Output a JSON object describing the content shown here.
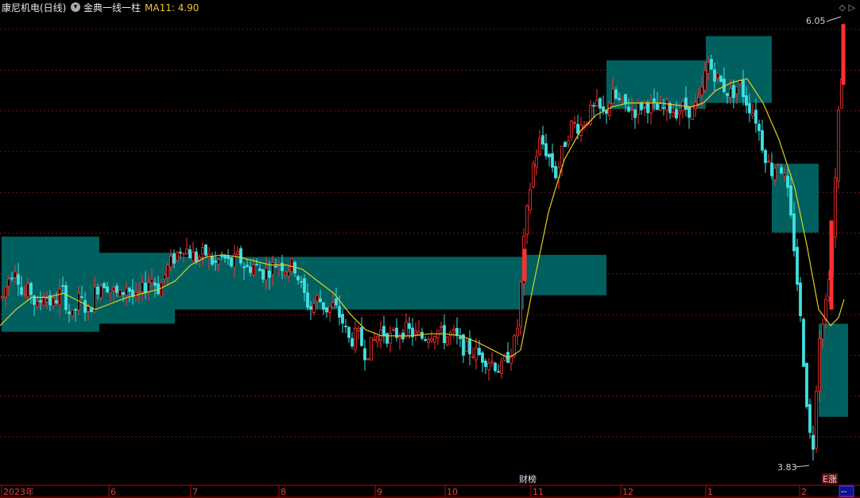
{
  "header": {
    "stock_name": "康尼机电(日线)",
    "indicator_icon": "chevron-down-icon",
    "indicator_name": "金典一线一柱",
    "ma_label": "MA11: 4.90",
    "top_icons": "◇ ▷"
  },
  "colors": {
    "background": "#000000",
    "up": "#ff3030",
    "down": "#40e0e0",
    "box": "#006060",
    "ma": "#e0d020",
    "axis": "#c00000",
    "grid": "#7a1010"
  },
  "annotations": {
    "high_label": "6.05",
    "low_label": "3.83",
    "event_caibang": "财榜",
    "event_zhang": "涨",
    "event_zhang_prefix": "E",
    "right_box": "--"
  },
  "chart_data": {
    "type": "candlestick",
    "title": "",
    "x_axis_labels": [
      "2023年",
      "6",
      "7",
      "8",
      "9",
      "10",
      "11",
      "12",
      "1",
      "2"
    ],
    "y_range": [
      3.83,
      6.05
    ],
    "high_value": 6.05,
    "low_value": 3.83,
    "ma_series_name": "MA11",
    "ma_last_value": 4.9,
    "grid": true,
    "price_path": [
      [
        0,
        4.62
      ],
      [
        10,
        4.75
      ],
      [
        20,
        4.82
      ],
      [
        28,
        4.66
      ],
      [
        38,
        4.7
      ],
      [
        46,
        4.6
      ],
      [
        55,
        4.68
      ],
      [
        66,
        4.62
      ],
      [
        78,
        4.7
      ],
      [
        90,
        4.55
      ],
      [
        100,
        4.66
      ],
      [
        112,
        4.58
      ],
      [
        120,
        4.7
      ],
      [
        130,
        4.74
      ],
      [
        140,
        4.7
      ],
      [
        150,
        4.66
      ],
      [
        160,
        4.72
      ],
      [
        170,
        4.64
      ],
      [
        180,
        4.7
      ],
      [
        190,
        4.76
      ],
      [
        200,
        4.7
      ],
      [
        210,
        4.8
      ],
      [
        220,
        4.86
      ],
      [
        230,
        4.92
      ],
      [
        238,
        4.88
      ],
      [
        248,
        4.85
      ],
      [
        258,
        4.88
      ],
      [
        270,
        4.82
      ],
      [
        280,
        4.86
      ],
      [
        290,
        4.82
      ],
      [
        300,
        4.86
      ],
      [
        310,
        4.8
      ],
      [
        320,
        4.82
      ],
      [
        330,
        4.78
      ],
      [
        340,
        4.8
      ],
      [
        350,
        4.84
      ],
      [
        360,
        4.8
      ],
      [
        370,
        4.82
      ],
      [
        380,
        4.7
      ],
      [
        390,
        4.6
      ],
      [
        400,
        4.66
      ],
      [
        410,
        4.6
      ],
      [
        420,
        4.62
      ],
      [
        430,
        4.55
      ],
      [
        440,
        4.44
      ],
      [
        450,
        4.48
      ],
      [
        460,
        4.38
      ],
      [
        470,
        4.44
      ],
      [
        480,
        4.5
      ],
      [
        490,
        4.46
      ],
      [
        500,
        4.48
      ],
      [
        510,
        4.5
      ],
      [
        520,
        4.48
      ],
      [
        530,
        4.46
      ],
      [
        540,
        4.48
      ],
      [
        550,
        4.5
      ],
      [
        560,
        4.46
      ],
      [
        570,
        4.48
      ],
      [
        580,
        4.42
      ],
      [
        590,
        4.4
      ],
      [
        600,
        4.38
      ],
      [
        610,
        4.36
      ],
      [
        620,
        4.34
      ],
      [
        630,
        4.3
      ],
      [
        640,
        4.38
      ],
      [
        650,
        4.46
      ],
      [
        660,
        4.98
      ],
      [
        670,
        5.3
      ],
      [
        680,
        5.44
      ],
      [
        690,
        5.36
      ],
      [
        700,
        5.26
      ],
      [
        710,
        5.42
      ],
      [
        720,
        5.52
      ],
      [
        730,
        5.5
      ],
      [
        740,
        5.56
      ],
      [
        750,
        5.6
      ],
      [
        760,
        5.56
      ],
      [
        770,
        5.66
      ],
      [
        780,
        5.62
      ],
      [
        790,
        5.6
      ],
      [
        800,
        5.58
      ],
      [
        810,
        5.62
      ],
      [
        820,
        5.6
      ],
      [
        830,
        5.58
      ],
      [
        840,
        5.6
      ],
      [
        850,
        5.58
      ],
      [
        860,
        5.6
      ],
      [
        870,
        5.58
      ],
      [
        880,
        5.62
      ],
      [
        890,
        5.82
      ],
      [
        900,
        5.76
      ],
      [
        910,
        5.7
      ],
      [
        920,
        5.66
      ],
      [
        930,
        5.72
      ],
      [
        940,
        5.62
      ],
      [
        950,
        5.56
      ],
      [
        960,
        5.4
      ],
      [
        970,
        5.28
      ],
      [
        980,
        5.34
      ],
      [
        990,
        5.2
      ],
      [
        1000,
        4.88
      ],
      [
        1008,
        4.5
      ],
      [
        1016,
        4.1
      ],
      [
        1022,
        3.86
      ],
      [
        1030,
        4.46
      ],
      [
        1040,
        4.66
      ],
      [
        1048,
        5.0
      ],
      [
        1055,
        5.56
      ],
      [
        1062,
        5.92
      ]
    ],
    "ma_path": [
      [
        0,
        4.52
      ],
      [
        20,
        4.6
      ],
      [
        40,
        4.66
      ],
      [
        60,
        4.66
      ],
      [
        80,
        4.68
      ],
      [
        100,
        4.64
      ],
      [
        120,
        4.6
      ],
      [
        140,
        4.63
      ],
      [
        160,
        4.66
      ],
      [
        180,
        4.68
      ],
      [
        200,
        4.7
      ],
      [
        220,
        4.74
      ],
      [
        240,
        4.82
      ],
      [
        260,
        4.86
      ],
      [
        280,
        4.87
      ],
      [
        300,
        4.86
      ],
      [
        320,
        4.84
      ],
      [
        340,
        4.82
      ],
      [
        360,
        4.82
      ],
      [
        380,
        4.8
      ],
      [
        400,
        4.74
      ],
      [
        420,
        4.68
      ],
      [
        440,
        4.58
      ],
      [
        460,
        4.5
      ],
      [
        480,
        4.47
      ],
      [
        500,
        4.47
      ],
      [
        520,
        4.47
      ],
      [
        540,
        4.48
      ],
      [
        560,
        4.48
      ],
      [
        580,
        4.47
      ],
      [
        600,
        4.44
      ],
      [
        620,
        4.4
      ],
      [
        640,
        4.36
      ],
      [
        655,
        4.4
      ],
      [
        670,
        4.7
      ],
      [
        690,
        5.08
      ],
      [
        710,
        5.34
      ],
      [
        730,
        5.48
      ],
      [
        750,
        5.56
      ],
      [
        770,
        5.6
      ],
      [
        790,
        5.62
      ],
      [
        810,
        5.62
      ],
      [
        830,
        5.62
      ],
      [
        850,
        5.61
      ],
      [
        870,
        5.6
      ],
      [
        885,
        5.62
      ],
      [
        900,
        5.68
      ],
      [
        920,
        5.72
      ],
      [
        940,
        5.74
      ],
      [
        960,
        5.62
      ],
      [
        980,
        5.44
      ],
      [
        1000,
        5.2
      ],
      [
        1015,
        4.92
      ],
      [
        1030,
        4.6
      ],
      [
        1045,
        4.52
      ],
      [
        1055,
        4.56
      ],
      [
        1062,
        4.65
      ]
    ],
    "zones": [
      {
        "x": [
          2,
          125
        ],
        "y": [
          4.49,
          4.96
        ]
      },
      {
        "x": [
          125,
          220
        ],
        "y": [
          4.53,
          4.88
        ]
      },
      {
        "x": [
          220,
          659
        ],
        "y": [
          4.6,
          4.86
        ]
      },
      {
        "x": [
          659,
          763
        ],
        "y": [
          4.67,
          4.87
        ]
      },
      {
        "x": [
          763,
          888
        ],
        "y": [
          5.59,
          5.83
        ]
      },
      {
        "x": [
          888,
          971
        ],
        "y": [
          5.62,
          5.95
        ]
      },
      {
        "x": [
          971,
          1030
        ],
        "y": [
          4.98,
          5.32
        ]
      },
      {
        "x": [
          1030,
          1067
        ],
        "y": [
          4.07,
          4.53
        ]
      }
    ],
    "volume_bars": [
      {
        "x": 660,
        "color": "up",
        "y": [
          4.74,
          4.9
        ]
      },
      {
        "x": 1046,
        "color": "up",
        "y": [
          4.6,
          5.04
        ]
      },
      {
        "x": 1061,
        "color": "up",
        "y": [
          5.71,
          6.01
        ]
      }
    ]
  }
}
